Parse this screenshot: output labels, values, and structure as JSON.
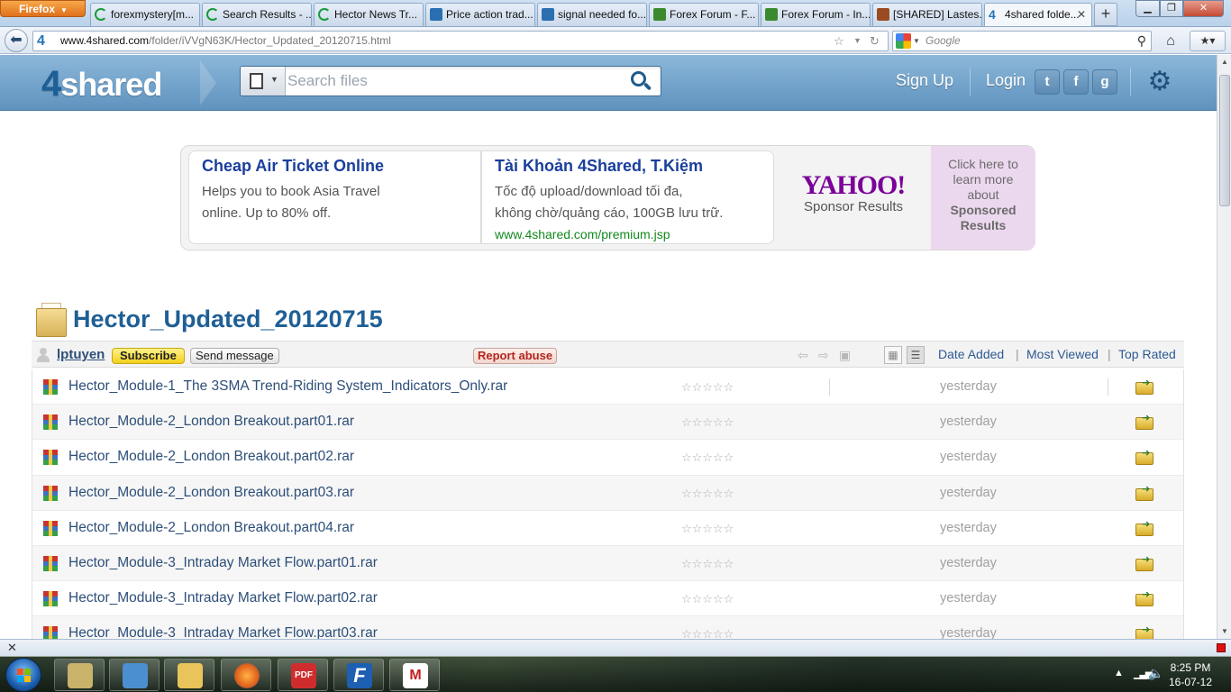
{
  "browser": {
    "menu_label": "Firefox",
    "tabs": [
      {
        "title": "forexmystery[m...",
        "icon": "spinner-icon"
      },
      {
        "title": "Search Results - ...",
        "icon": "spinner-icon"
      },
      {
        "title": "Hector News Tr...",
        "icon": "spinner-icon"
      },
      {
        "title": "Price action trad...",
        "icon": "forum-icon"
      },
      {
        "title": "signal needed fo...",
        "icon": "forum-icon"
      },
      {
        "title": "Forex Forum - F...",
        "icon": "forex-forum-icon"
      },
      {
        "title": "Forex Forum - In...",
        "icon": "forex-forum-icon"
      },
      {
        "title": "[SHARED] Lastes...",
        "icon": "book-icon"
      },
      {
        "title": "4shared folde...",
        "icon": "4shared-icon"
      }
    ],
    "new_tab": "+",
    "url_domain": "www.4shared.com",
    "url_path": "/folder/iVVgN63K/Hector_Updated_20120715.html",
    "search_engine_placeholder": "Google"
  },
  "site": {
    "logo_four": "4",
    "logo_text": "shared",
    "search_placeholder": "Search files",
    "signup": "Sign Up",
    "login": "Login",
    "social": {
      "twitter": "t",
      "facebook": "f",
      "google": "g"
    }
  },
  "ads": [
    {
      "title": "Cheap Air Ticket Online",
      "line1": "Helps you to book Asia Travel",
      "line2": "online. Up to 80% off.",
      "url": ""
    },
    {
      "title": "Tài Khoản 4Shared, T.Kiệm",
      "line1": "Tốc độ upload/download tối đa,",
      "line2": "không chờ/quảng cáo, 100GB lưu trữ.",
      "url": "www.4shared.com/premium.jsp"
    }
  ],
  "sponsor": {
    "logo": "YAHOO!",
    "label": "Sponsor Results",
    "info_line1": "Click here to",
    "info_line2": "learn more",
    "info_line3": "about",
    "info_bold1": "Sponsored",
    "info_bold2": "Results"
  },
  "folder": {
    "title": "Hector_Updated_20120715",
    "owner": "lptuyen",
    "subscribe": "Subscribe",
    "send_message": "Send message",
    "report_abuse": "Report abuse",
    "sort": {
      "date_added": "Date Added",
      "most_viewed": "Most Viewed",
      "top_rated": "Top Rated",
      "separator": "|"
    }
  },
  "files": [
    {
      "name": "Hector_Module-1_The 3SMA Trend-Riding System_Indicators_Only.rar",
      "rating": "☆☆☆☆☆",
      "date": "yesterday"
    },
    {
      "name": "Hector_Module-2_London Breakout.part01.rar",
      "rating": "☆☆☆☆☆",
      "date": "yesterday"
    },
    {
      "name": "Hector_Module-2_London Breakout.part02.rar",
      "rating": "☆☆☆☆☆",
      "date": "yesterday"
    },
    {
      "name": "Hector_Module-2_London Breakout.part03.rar",
      "rating": "☆☆☆☆☆",
      "date": "yesterday"
    },
    {
      "name": "Hector_Module-2_London Breakout.part04.rar",
      "rating": "☆☆☆☆☆",
      "date": "yesterday"
    },
    {
      "name": "Hector_Module-3_Intraday Market Flow.part01.rar",
      "rating": "☆☆☆☆☆",
      "date": "yesterday"
    },
    {
      "name": "Hector_Module-3_Intraday Market Flow.part02.rar",
      "rating": "☆☆☆☆☆",
      "date": "yesterday"
    },
    {
      "name": "Hector_Module-3_Intraday Market Flow.part03.rar",
      "rating": "☆☆☆☆☆",
      "date": "yesterday"
    }
  ],
  "taskbar": {
    "time": "8:25 PM",
    "date": "16-07-12",
    "apps": [
      {
        "name": "tb-app-network",
        "label": ""
      },
      {
        "name": "tb-app-paint",
        "label": ""
      },
      {
        "name": "tb-app-explorer",
        "label": ""
      },
      {
        "name": "tb-app-firefox",
        "label": ""
      },
      {
        "name": "tb-app-pdf",
        "label": "PDF"
      },
      {
        "name": "tb-app-f",
        "label": "F"
      },
      {
        "name": "tb-app-mt",
        "label": "M"
      }
    ]
  },
  "colors": {
    "site_header": "#6f9ec7",
    "link_blue": "#2d4f78",
    "folder_title": "#1f5f96",
    "ad_title": "#1a3f9c",
    "ad_url": "#128a1f",
    "yahoo": "#7b0099",
    "subscribe_yellow": "#f1cf1c",
    "report_red": "#b3261e"
  }
}
